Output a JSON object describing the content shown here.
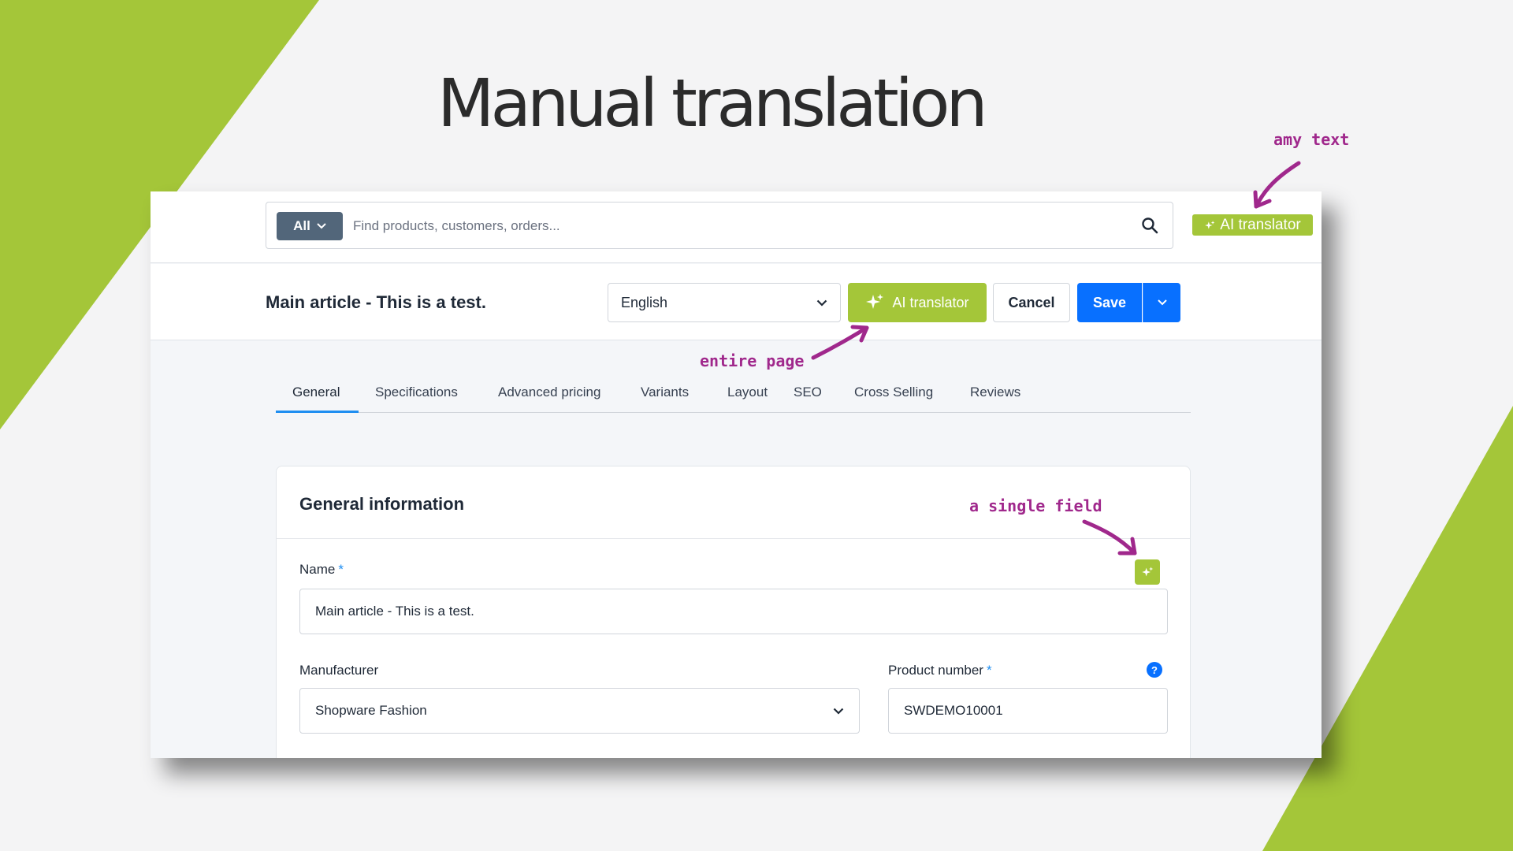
{
  "slide": {
    "title": "Manual translation"
  },
  "search": {
    "scope_label": "All",
    "placeholder": "Find products, customers, orders..."
  },
  "header": {
    "title": "Main article - This is a test.",
    "language": "English",
    "ai_translator_label": "AI translator",
    "cancel_label": "Cancel",
    "save_label": "Save"
  },
  "tabs": [
    {
      "label": "General",
      "active": true
    },
    {
      "label": "Specifications"
    },
    {
      "label": "Advanced pricing"
    },
    {
      "label": "Variants"
    },
    {
      "label": "Layout"
    },
    {
      "label": "SEO"
    },
    {
      "label": "Cross Selling"
    },
    {
      "label": "Reviews"
    }
  ],
  "card": {
    "title": "General information",
    "name_label": "Name",
    "name_value": "Main article - This is a test.",
    "manufacturer_label": "Manufacturer",
    "manufacturer_value": "Shopware Fashion",
    "product_number_label": "Product number",
    "product_number_value": "SWDEMO10001",
    "required_marker": "*",
    "help_glyph": "?"
  },
  "ai_badge": {
    "label": "AI translator"
  },
  "annotations": {
    "amy_text": "amy text",
    "entire_page": "entire page",
    "single_field": "a single field"
  },
  "colors": {
    "accent_green": "#a4c639",
    "primary_blue": "#0870ff",
    "annotation_purple": "#a0288c"
  },
  "icons": [
    "search-icon",
    "chevron-down-icon",
    "sparkle-icon",
    "help-icon"
  ]
}
